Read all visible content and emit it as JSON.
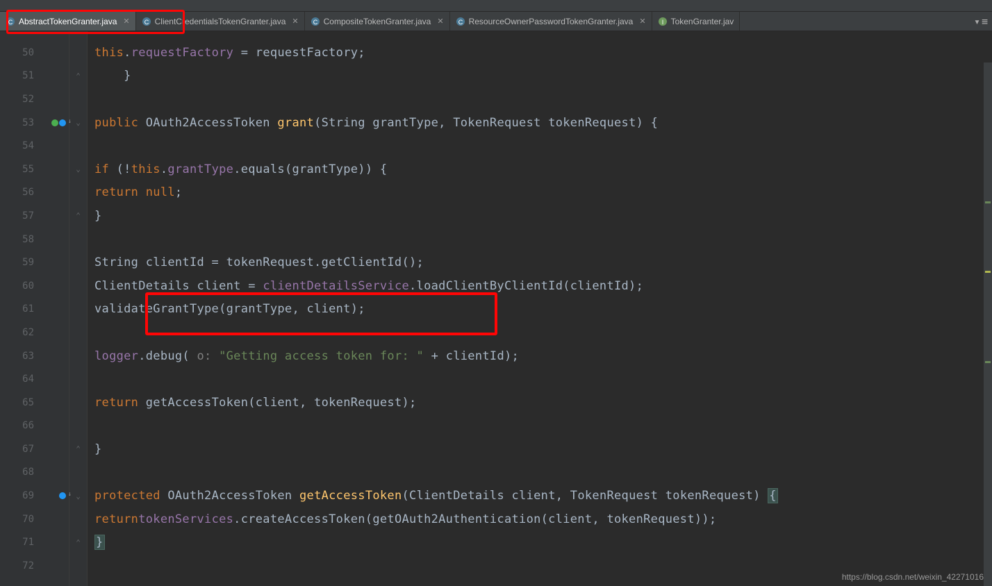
{
  "tabs": [
    {
      "name": "AbstractTokenGranter.java",
      "active": true
    },
    {
      "name": "ClientCredentialsTokenGranter.java",
      "active": false
    },
    {
      "name": "CompositeTokenGranter.java",
      "active": false
    },
    {
      "name": "ResourceOwnerPasswordTokenGranter.java",
      "active": false
    },
    {
      "name": "TokenGranter.jav",
      "active": false
    }
  ],
  "lines": {
    "50": {
      "num": "50"
    },
    "51": {
      "num": "51"
    },
    "52": {
      "num": "52"
    },
    "53": {
      "num": "53"
    },
    "54": {
      "num": "54"
    },
    "55": {
      "num": "55"
    },
    "56": {
      "num": "56"
    },
    "57": {
      "num": "57"
    },
    "58": {
      "num": "58"
    },
    "59": {
      "num": "59"
    },
    "60": {
      "num": "60"
    },
    "61": {
      "num": "61"
    },
    "62": {
      "num": "62"
    },
    "63": {
      "num": "63"
    },
    "64": {
      "num": "64"
    },
    "65": {
      "num": "65"
    },
    "66": {
      "num": "66"
    },
    "67": {
      "num": "67"
    },
    "68": {
      "num": "68"
    },
    "69": {
      "num": "69"
    },
    "70": {
      "num": "70"
    },
    "71": {
      "num": "71"
    },
    "72": {
      "num": "72"
    }
  },
  "code": {
    "t_this": "this",
    "t_requestFactory": "requestFactory",
    "t_eq_requestFactory": " = requestFactory;",
    "t_public": "public",
    "t_OAuth2AccessToken": " OAuth2AccessToken ",
    "t_grant": "grant",
    "t_grant_params": "(String grantType, TokenRequest tokenRequest) {",
    "t_if": "if",
    "t_if_cond1": " (!",
    "t_grantType": "grantType",
    "t_equals": ".equals(grantType)) {",
    "t_return": "return",
    "t_null": " null",
    "t_semi": ";",
    "t_close_brace": "}",
    "t_string_clientid": "String clientId = tokenRequest.getClientId();",
    "t_clientdetails": "ClientDetails client = ",
    "t_clientDetailsService": "clientDetailsService",
    "t_loadclient": ".loadClientByClientId(clientId);",
    "t_validate": "validateGrantType(grantType, client);",
    "t_logger": "logger",
    "t_debug": ".debug(",
    "t_hint": " o: ",
    "t_debug_str": "\"Getting access token for: \"",
    "t_debug_end": " + clientId);",
    "t_getAccessToken": " getAccessToken(client, tokenRequest);",
    "t_protected": "protected",
    "t_getAccessToken_name": "getAccessToken",
    "t_gat_params": "(ClientDetails client, TokenRequest tokenRequest) ",
    "t_open_brace": "{",
    "t_tokenServices": "tokenServices",
    "t_createAccess": ".createAccessToken(getOAuth2Authentication(client, tokenRequest));",
    "t_dot": "."
  },
  "watermark": "https://blog.csdn.net/weixin_42271016"
}
